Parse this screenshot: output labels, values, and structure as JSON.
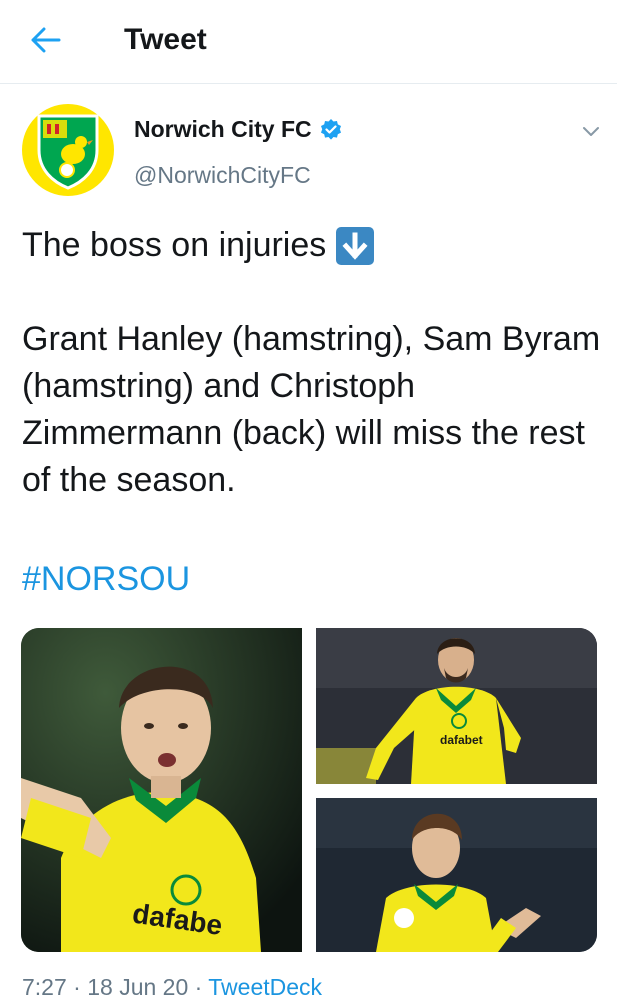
{
  "header": {
    "title": "Tweet",
    "back_icon": "arrow-left-icon",
    "accent": "#1da1f2"
  },
  "author": {
    "name": "Norwich City FC",
    "handle": "@NorwichCityFC",
    "verified": true,
    "avatar_color": "#ffe600"
  },
  "tweet": {
    "line1": "The boss on injuries",
    "emoji": "down-arrow-emoji",
    "paragraph": "Grant Hanley (hamstring), Sam Byram (hamstring) and Christoph Zimmermann (back) will miss the rest of the season.",
    "hashtag": "#NORSOU"
  },
  "media": {
    "photos": [
      {
        "subject": "player-pointing",
        "shirt_text": "dafabe"
      },
      {
        "subject": "player-running",
        "shirt_text": "dafabet"
      },
      {
        "subject": "player-clapping",
        "shirt_text": ""
      }
    ]
  },
  "meta": {
    "time": "7:27",
    "sep1": " · ",
    "date": "18 Jun 20",
    "sep2": " · ",
    "source": "TweetDeck"
  }
}
